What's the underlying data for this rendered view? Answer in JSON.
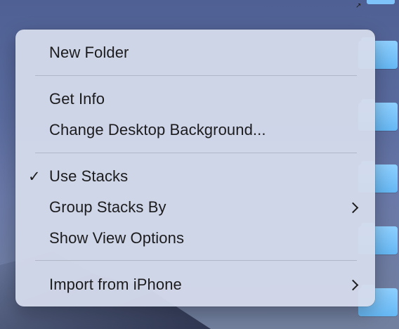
{
  "desktop": {
    "alias_arrow": "↗"
  },
  "menu": {
    "items": [
      {
        "label": "New Folder"
      },
      {
        "label": "Get Info"
      },
      {
        "label": "Change Desktop Background..."
      },
      {
        "label": "Use Stacks",
        "checked": true,
        "check_glyph": "✓"
      },
      {
        "label": "Group Stacks By",
        "submenu": true
      },
      {
        "label": "Show View Options"
      },
      {
        "label": "Import from iPhone",
        "submenu": true
      }
    ]
  },
  "colors": {
    "menu_bg": "#d6dcec",
    "text": "#1c1c1e",
    "folder": "#7ec4fa"
  }
}
